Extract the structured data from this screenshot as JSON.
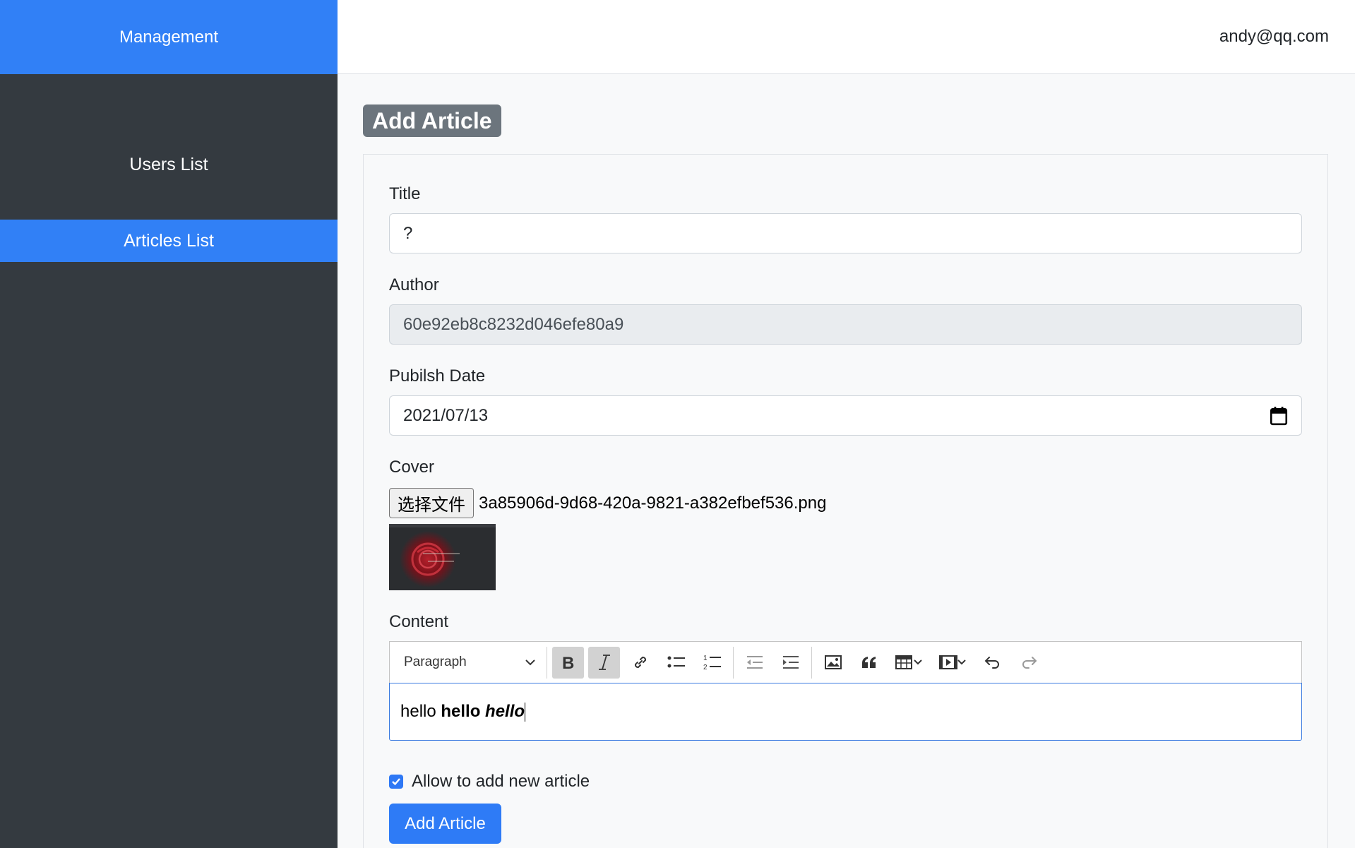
{
  "sidebar": {
    "brand": "Management",
    "items": [
      {
        "label": "Users List"
      },
      {
        "label": "Articles List"
      }
    ]
  },
  "header": {
    "user_email": "andy@qq.com"
  },
  "page": {
    "title": "Add Article"
  },
  "form": {
    "title": {
      "label": "Title",
      "value": "?"
    },
    "author": {
      "label": "Author",
      "value": "60e92eb8c8232d046efe80a9"
    },
    "publish_date": {
      "label": "Pubilsh Date",
      "value": "2021/07/13"
    },
    "cover": {
      "label": "Cover",
      "button_label": "选择文件",
      "file_name": "3a85906d-9d68-420a-9821-a382efbef536.png"
    },
    "content": {
      "label": "Content",
      "block_type": "Paragraph",
      "text_plain": "hello ",
      "text_bold": "hello ",
      "text_bold_italic": "hello"
    },
    "allow": {
      "label": "Allow to add new article",
      "checked": true
    },
    "submit_label": "Add Article"
  },
  "colors": {
    "accent": "#3180f6",
    "sidebar_bg": "#343a40",
    "title_badge": "#6c757d"
  }
}
